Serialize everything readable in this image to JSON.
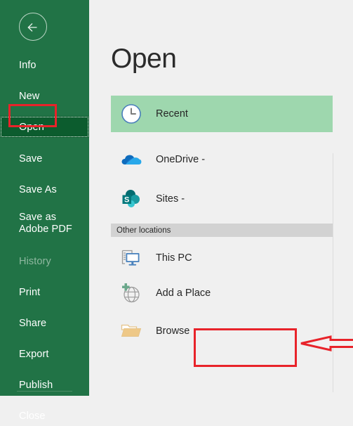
{
  "window": {
    "app_theme_color": "#217346",
    "panel_background": "#f0f0f0"
  },
  "sidebar": {
    "back_button": {
      "name": "back-arrow-button",
      "label": "Back"
    },
    "items": [
      {
        "label": "Info",
        "state": "normal",
        "icon": "none"
      },
      {
        "label": "New",
        "state": "normal",
        "icon": "none"
      },
      {
        "label": "Open",
        "state": "selected",
        "icon": "none"
      },
      {
        "label": "Save",
        "state": "normal",
        "icon": "none"
      },
      {
        "label": "Save As",
        "state": "normal",
        "icon": "none"
      },
      {
        "label": "Save as Adobe PDF",
        "state": "normal",
        "icon": "none"
      },
      {
        "label": "History",
        "state": "disabled",
        "icon": "none"
      },
      {
        "label": "Print",
        "state": "normal",
        "icon": "none"
      },
      {
        "label": "Share",
        "state": "normal",
        "icon": "none"
      },
      {
        "label": "Export",
        "state": "normal",
        "icon": "none"
      },
      {
        "label": "Publish",
        "state": "normal",
        "icon": "none"
      },
      {
        "label": "Close",
        "state": "normal",
        "icon": "none"
      }
    ]
  },
  "main": {
    "title": "Open",
    "places": [
      {
        "label": "Recent",
        "icon": "clock-icon",
        "selected": true
      },
      {
        "label": "OneDrive -",
        "icon": "onedrive-icon",
        "selected": false
      },
      {
        "label": "Sites -",
        "icon": "sharepoint-icon",
        "selected": false
      }
    ],
    "other_locations_header": "Other locations",
    "other_locations": [
      {
        "label": "This PC",
        "icon": "this-pc-icon"
      },
      {
        "label": "Add a Place",
        "icon": "add-a-place-icon"
      },
      {
        "label": "Browse",
        "icon": "folder-icon"
      }
    ]
  },
  "annotations": {
    "color": "#e8232a",
    "highlight_open": "Open",
    "highlight_browse": "Browse",
    "arrow_points_to": "Browse"
  }
}
